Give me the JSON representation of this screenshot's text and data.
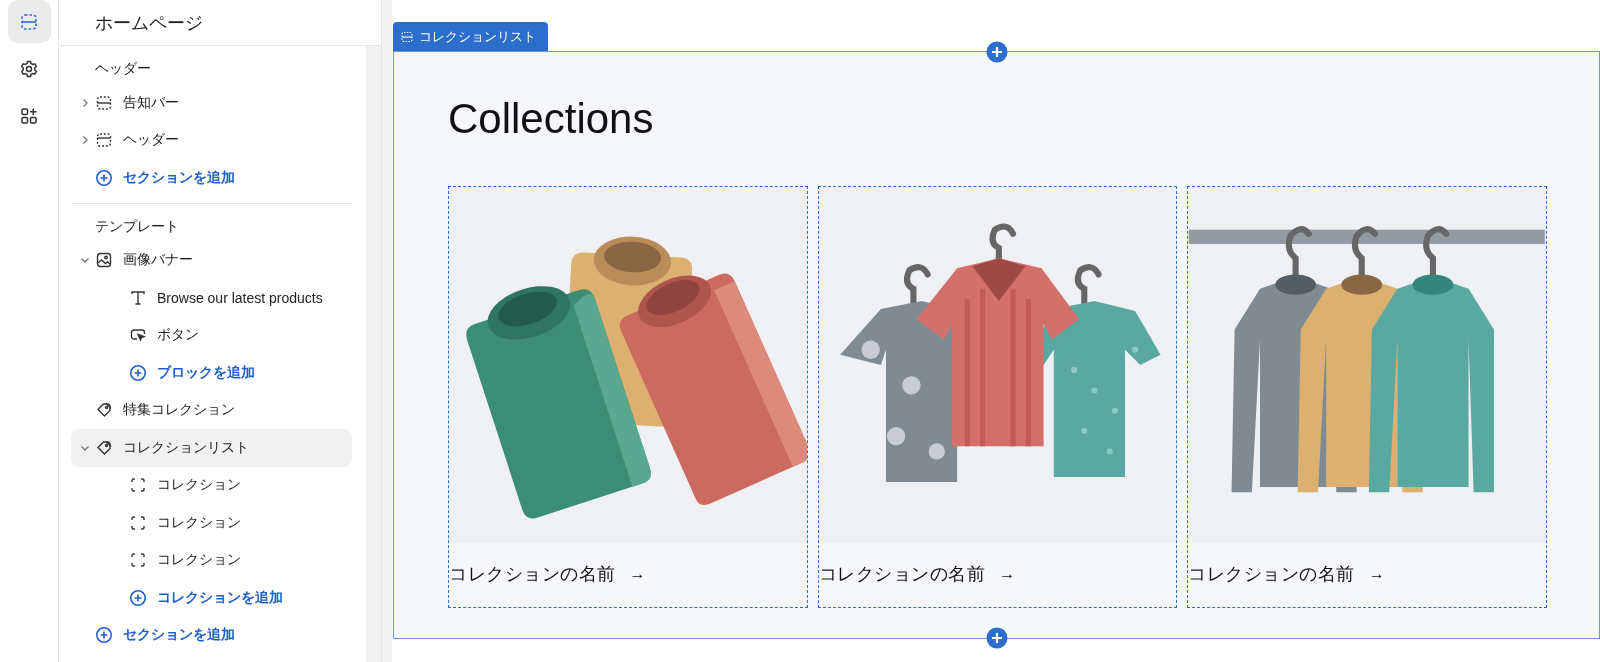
{
  "rail": [
    {
      "kind": "sections",
      "selected": true
    },
    {
      "kind": "settings",
      "selected": false
    },
    {
      "kind": "apps",
      "selected": false
    }
  ],
  "page_title": "ホームページ",
  "groups": [
    {
      "title": "ヘッダー",
      "items": [
        {
          "kind": "bar",
          "label": "告知バー",
          "expanded": false,
          "selected": false
        },
        {
          "kind": "header",
          "label": "ヘッダー",
          "expanded": false,
          "selected": false
        },
        {
          "kind": "add",
          "label": "セクションを追加"
        }
      ]
    },
    {
      "title": "テンプレート",
      "items": [
        {
          "kind": "image",
          "label": "画像バナー",
          "expanded": true,
          "selected": false,
          "children": [
            {
              "kind": "text",
              "label": "Browse our latest products"
            },
            {
              "kind": "button",
              "label": "ボタン"
            },
            {
              "kind": "add",
              "label": "ブロックを追加"
            }
          ]
        },
        {
          "kind": "tag",
          "label": "特集コレクション",
          "selected": false
        },
        {
          "kind": "tag",
          "label": "コレクションリスト",
          "expanded": true,
          "selected": true,
          "children": [
            {
              "kind": "block",
              "label": "コレクション"
            },
            {
              "kind": "block",
              "label": "コレクション"
            },
            {
              "kind": "block",
              "label": "コレクション"
            },
            {
              "kind": "add",
              "label": "コレクションを追加"
            }
          ]
        },
        {
          "kind": "add",
          "label": "セクションを追加"
        }
      ]
    }
  ],
  "preview": {
    "section_tab": "コレクションリスト",
    "heading": "Collections",
    "cards": [
      {
        "kind": "folded",
        "caption": "コレクションの名前",
        "arrow": "→"
      },
      {
        "kind": "hanging",
        "caption": "コレクションの名前",
        "arrow": "→"
      },
      {
        "kind": "rack",
        "caption": "コレクションの名前",
        "arrow": "→"
      }
    ]
  }
}
